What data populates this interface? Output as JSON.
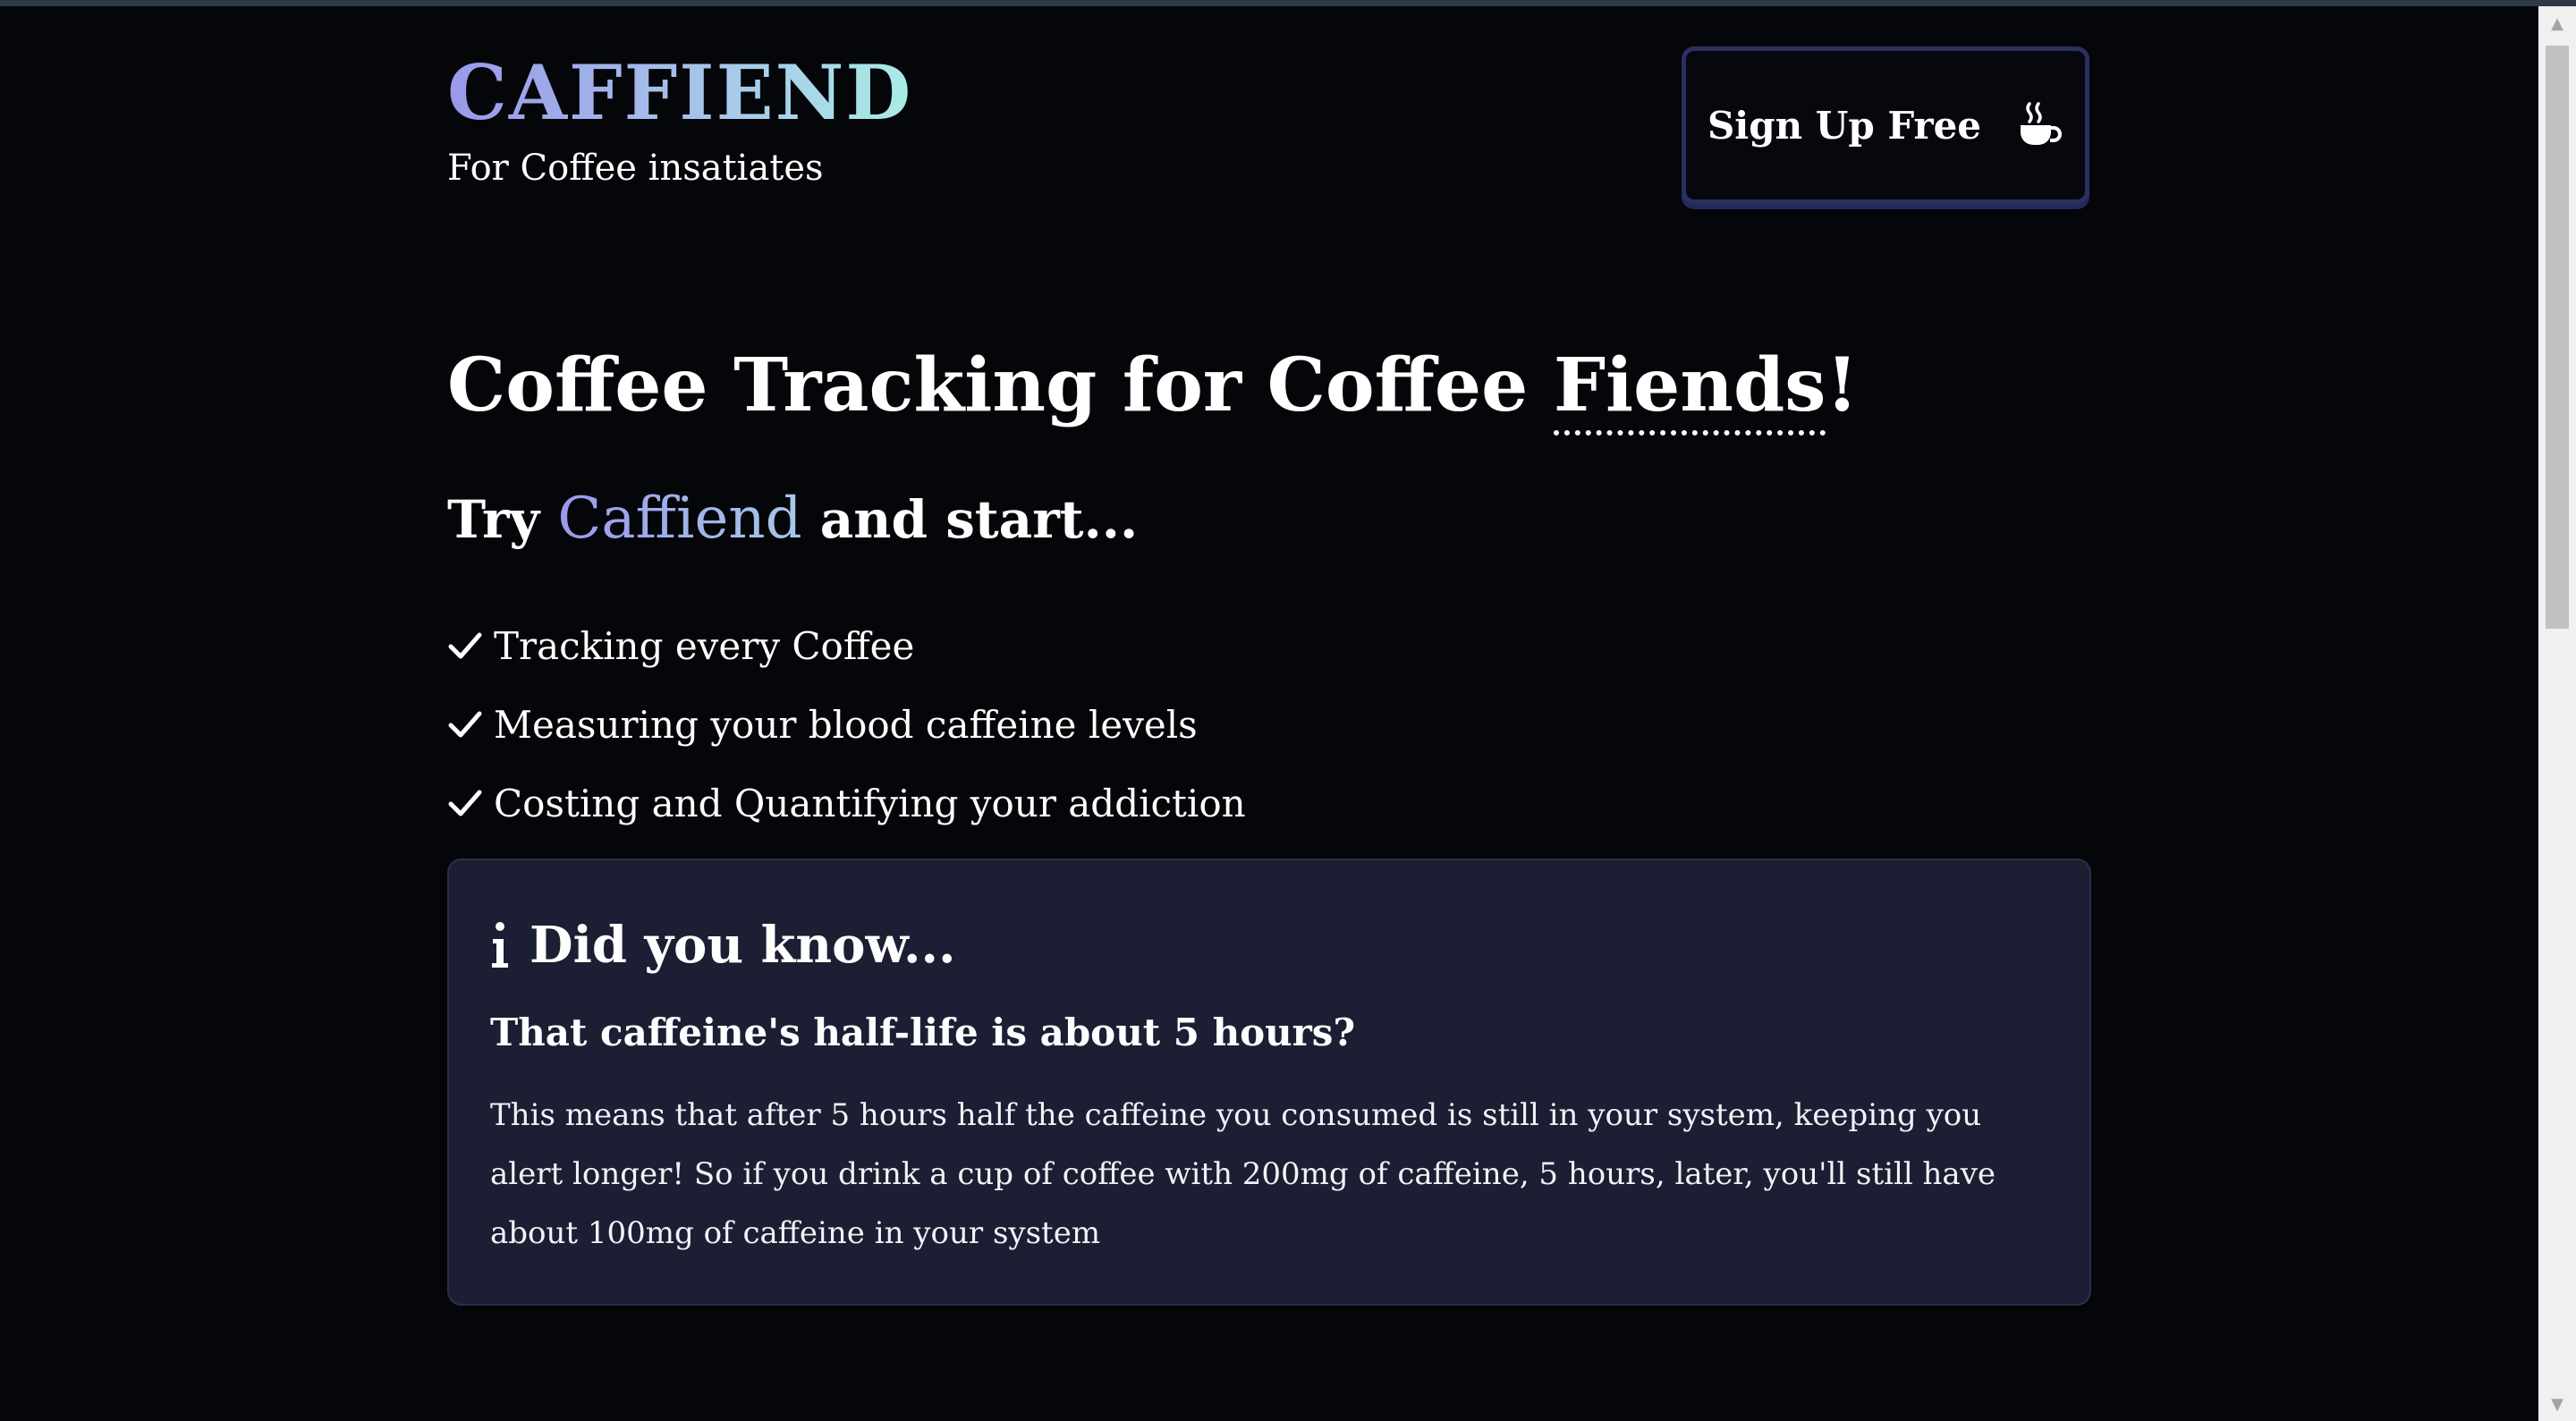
{
  "header": {
    "logo": "CAFFIEND",
    "tagline": "For Coffee insatiates",
    "signup_label": "Sign Up Free",
    "signup_icon": "coffee-mug-icon"
  },
  "hero": {
    "title_prefix": "Coffee Tracking for Coffee ",
    "title_emphasis": "Fiends",
    "title_suffix": "!",
    "subtitle_prefix": "Try ",
    "subtitle_brand": "Caffiend",
    "subtitle_suffix": " and start...",
    "features": [
      "Tracking every Coffee",
      "Measuring your blood caffeine levels",
      "Costing and Quantifying your addiction"
    ]
  },
  "info": {
    "icon": "info-icon",
    "heading": "Did you know...",
    "subheading": "That caffeine's half-life is about 5 hours?",
    "body": "This means that after 5 hours half the caffeine you consumed is still in your system, keeping you alert longer! So if you drink a cup of coffee with 200mg of caffeine, 5 hours, later, you'll still have about 100mg of caffeine in your system"
  },
  "colors": {
    "background": "#050609",
    "card": "#1c1f33",
    "accent_start": "#9a98ea",
    "accent_end": "#a9ece6"
  }
}
